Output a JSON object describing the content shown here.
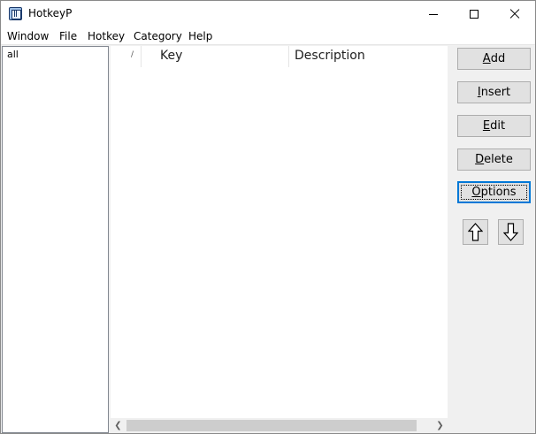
{
  "window": {
    "title": "HotkeyP"
  },
  "menu": {
    "items": [
      "Window",
      "File",
      "Hotkey",
      "Category",
      "Help"
    ]
  },
  "categories": {
    "items": [
      "all"
    ]
  },
  "list": {
    "columns": {
      "marker": "/",
      "key": "Key",
      "description": "Description"
    },
    "rows": []
  },
  "buttons": {
    "add": {
      "mnemonic": "A",
      "rest": "dd"
    },
    "insert": {
      "mnemonic": "I",
      "rest": "nsert"
    },
    "edit": {
      "mnemonic": "E",
      "rest": "dit"
    },
    "delete": {
      "mnemonic": "D",
      "rest": "elete"
    },
    "options": {
      "mnemonic": "O",
      "rest": "ptions"
    }
  },
  "icons": {
    "app": "hotkeyp-app-icon",
    "move_up": "arrow-up-icon",
    "move_down": "arrow-down-icon"
  }
}
